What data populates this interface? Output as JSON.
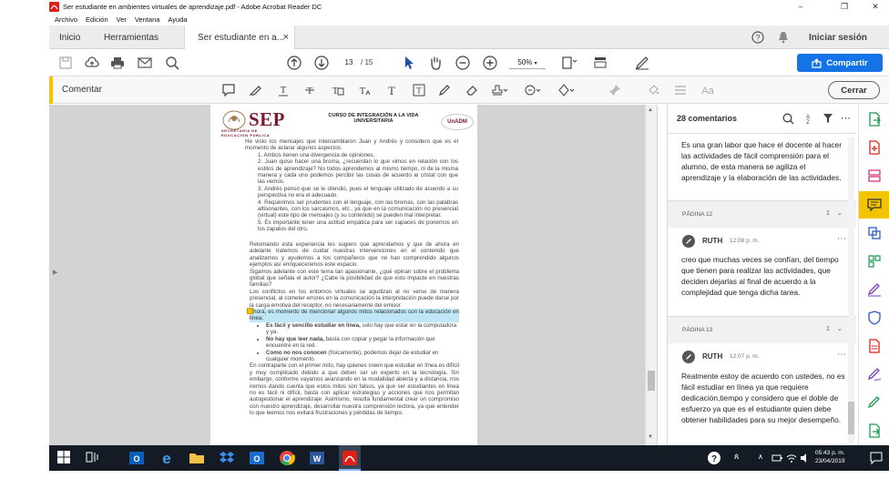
{
  "window": {
    "title": "Ser estudiante en ambientes virtuales de aprendizaje.pdf - Adobe Acrobat Reader DC",
    "controls": [
      "–",
      "❐",
      "✕"
    ]
  },
  "menu": [
    "Archivo",
    "Edición",
    "Ver",
    "Ventana",
    "Ayuda"
  ],
  "tabs": {
    "home": "Inicio",
    "tools": "Herramientas",
    "doc": "Ser estudiante en a...",
    "close": "×",
    "signin": "Iniciar sesión"
  },
  "toolbar": {
    "page_current": "13",
    "page_total": "/ 15",
    "zoom": "50%",
    "share": "Compartir"
  },
  "commentbar": {
    "label": "Comentar",
    "close": "Cerrar"
  },
  "document": {
    "logo": "SEP",
    "logo_sub1": "SECRETARÍA DE",
    "logo_sub2": "EDUCACIÓN PÚBLICA",
    "course_line1": "CURSO DE INTEGRACIÓN A LA VIDA",
    "course_line2": "UNIVERSITARIA",
    "unadm": "UnADM",
    "paragraphs": [
      "He visto los mensajes que intercambiaron Juan y Andrés y considero que es el momento de aclarar algunos aspectos:",
      "1. Ambos tienen una divergencia de opiniones.",
      "2. Juan quiso hacer una broma, ¿recuerdan lo que vimos en relación con los estilos de aprendizaje? No todos aprendemos al mismo tiempo, ni de la misma manera y cada uno podemos percibir las cosas de acuerdo al cristal con que las vemos.",
      "3. Andrés pensó que se le ofendió, pues el lenguaje utilizado de acuerdo a su perspectiva no era el adecuado.",
      "4. Requerimos ser prudentes con el lenguaje, con las bromas, con las palabras altisonantes, con los sarcasmos, etc., ya que en la comunicación no presencial (virtual) este tipo de mensajes (y su contenido) se pueden mal interpretar.",
      "5. Es importante tener una actitud empática para ser capaces de ponernos en los zapatos del otro.",
      "Retomando esta experiencia les sugiero que aprendamos y que de ahora en adelante tratemos de cuidar nuestras intervenciones en el contenido que analizamos y ayudemos a los compañeros que no han comprendido algunos ejemplos así enriqueceremos este espacio.",
      "Sigamos adelante con este tema tan apasionante, ¿qué opinan sobre el problema global que señala el autor? ¿Cabe la posibilidad de que esto impacte en nuestras familias?",
      "Los conflictos en los entornos virtuales se agudizan al no verse de manera presencial, al cometer errores en la comunicación la interpretación puede darse por la carga emotiva del receptor, no necesariamente del emisor."
    ],
    "highlight": "Ahora, es momento de mencionar algunos mitos relacionados con la educación en línea:",
    "bullets": [
      {
        "bold": "Es fácil y sencillo estudiar en línea,",
        "rest": " solo hay que estar en la computadora y ya."
      },
      {
        "bold": "No hay que leer nada,",
        "rest": " basta con copiar y pegar la información que encuentre en la red."
      },
      {
        "bold": "Como no nos conocen",
        "rest": " (físicamente), podemos dejar de estudiar en cualquier momento."
      }
    ],
    "closing": "En contraparte con el primer mito, hay quienes creen que estudiar en línea es difícil y muy complicado debido a que deben ser un experto en la tecnología. Sin embargo, conforme vayamos avanzando en la modalidad abierta y a distancia, nos iremos dando cuenta que estos mitos son falsos, ya que ser estudiantes en línea no es fácil ni difícil, basta con aplicar estrategias y acciones que nos permitan autogestionar el aprendizaje. Asimismo, resulta fundamental crear un compromiso con nuestro aprendizaje, desarrollar nuestra comprensión lectora, ya que entender lo que leemos nos evitará frustraciones y pérdidas de tiempo."
  },
  "comments_panel": {
    "count": "28 comentarios",
    "first_text": "Es una gran labor que hace el docente al hacer las actividades de fácil comprensión para el alumno, de esta manera se agiliza el aprendizaje y la elaboración de las actividades.",
    "groups": [
      {
        "page": "PÁGINA 12",
        "count": "1",
        "author": "RUTH",
        "time": "12:08 p. m.",
        "text": "creo que muchas veces se confían, del tiempo que tienen para realizar las actividades, que deciden dejarlas al final de acuerdo a la complejidad que tenga dicha tarea."
      },
      {
        "page": "PÁGINA 13",
        "count": "1",
        "author": "RUTH",
        "time": "12:07 p. m.",
        "text": "Realmente estoy de acuerdo con ustedes, no es fácil estudiar en línea ya que requiere dedicación,tiempo y considero que el doble de esfuerzo ya que es el estudiante quien debe obtener habilidades para su mejor desempeño."
      }
    ]
  },
  "taskbar": {
    "time": "05:43 p. m.",
    "date": "23/04/2019"
  },
  "colors": {
    "acrobat_red": "#e0211a",
    "share_blue": "#1473e6",
    "comment_yellow": "#f4c300",
    "highlight": "#bfe7f7",
    "taskbar": "#141b25"
  }
}
